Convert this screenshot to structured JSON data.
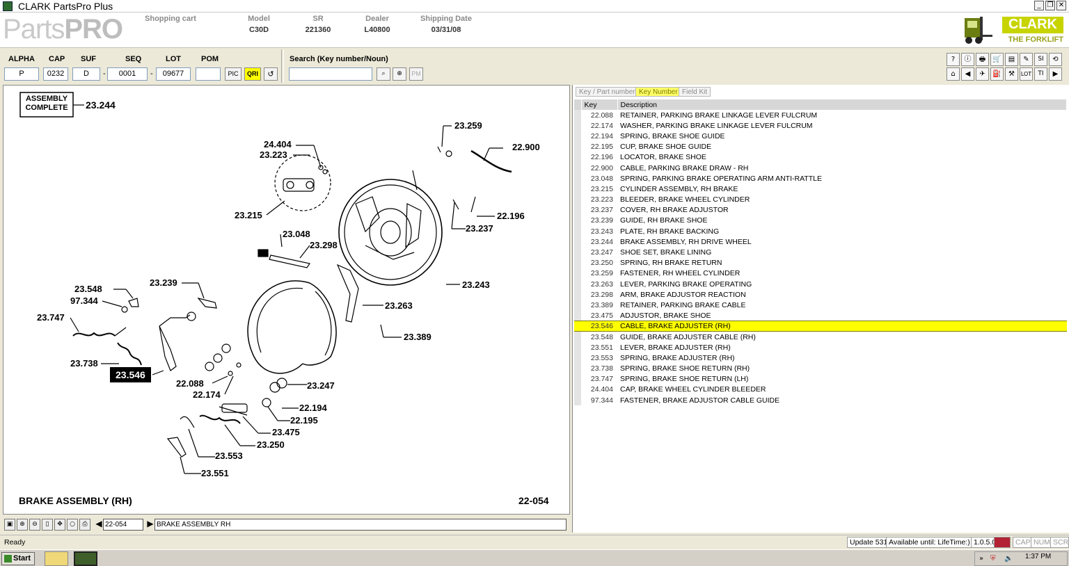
{
  "window": {
    "title": "CLARK PartsPro Plus",
    "minimize": "_",
    "restore": "❐",
    "close": "✕"
  },
  "header": {
    "logo_light": "Parts",
    "logo_bold": "PRO",
    "fields": [
      {
        "label": "Shopping cart",
        "value": ""
      },
      {
        "label": "Model",
        "value": "C30D"
      },
      {
        "label": "SR",
        "value": "221360"
      },
      {
        "label": "Dealer",
        "value": "L40800"
      },
      {
        "label": "Shipping Date",
        "value": "03/31/08"
      }
    ],
    "brand_name": "CLARK",
    "brand_tagline": "THE FORKLIFT",
    "brand_color": "#c8d400"
  },
  "lookup": {
    "alpha_label": "ALPHA",
    "alpha_value": "P",
    "cap_label": "CAP",
    "cap_value": "0232",
    "suf_label": "SUF",
    "suf_value": "D",
    "seq_label": "SEQ",
    "seq_value": "0001",
    "lot_label": "LOT",
    "lot_value": "09677",
    "pom_label": "POM",
    "pom_value": "",
    "dash": "-",
    "pic_button": "PIC",
    "qri_button": "QRI",
    "qri_color": "#ffff00",
    "search_label": "Search (Key number/Noun)",
    "search_value": "",
    "pm_button": "PM"
  },
  "right_toolbar": {
    "row1": [
      "?",
      "ⓘ",
      "🖶",
      "🛒",
      "▤",
      "✎",
      "SI",
      "⟲"
    ],
    "row2": [
      "⌂",
      "◀",
      "✈",
      "⛽",
      "⚒",
      "LOT",
      "TI",
      "▶"
    ]
  },
  "drawing": {
    "assembly_label_line1": "ASSEMBLY",
    "assembly_label_line2": "COMPLETE",
    "assembly_key": "23.244",
    "title": "BRAKE ASSEMBLY (RH)",
    "number": "22-054",
    "highlight_key": "23.546",
    "callouts": [
      "23.259",
      "22.900",
      "24.404",
      "23.223",
      "23.215",
      "22.196",
      "23.237",
      "23.048",
      "23.298",
      "23.243",
      "23.548",
      "97.344",
      "23.239",
      "23.263",
      "23.747",
      "23.389",
      "23.738",
      "22.088",
      "23.247",
      "22.174",
      "22.194",
      "22.195",
      "23.475",
      "23.250",
      "23.553",
      "23.551"
    ]
  },
  "drawing_nav": {
    "page_value": "22-054",
    "description_value": "BRAKE ASSEMBLY RH"
  },
  "parts_panel": {
    "tabs": [
      "Key / Part number",
      "Key Number",
      "Field Kit"
    ],
    "active_tab": 1,
    "columns": [
      "Key",
      "Description"
    ],
    "selected_index": 18,
    "rows": [
      {
        "key": "22.088",
        "desc": "RETAINER, PARKING BRAKE LINKAGE LEVER FULCRUM"
      },
      {
        "key": "22.174",
        "desc": "WASHER, PARKING BRAKE LINKAGE LEVER FULCRUM"
      },
      {
        "key": "22.194",
        "desc": "SPRING, BRAKE SHOE GUIDE"
      },
      {
        "key": "22.195",
        "desc": "CUP, BRAKE SHOE GUIDE"
      },
      {
        "key": "22.196",
        "desc": "LOCATOR, BRAKE SHOE"
      },
      {
        "key": "22.900",
        "desc": "CABLE, PARKING BRAKE DRAW - RH"
      },
      {
        "key": "23.048",
        "desc": "SPRING, PARKING BRAKE OPERATING ARM ANTI-RATTLE"
      },
      {
        "key": "23.215",
        "desc": "CYLINDER ASSEMBLY, RH BRAKE"
      },
      {
        "key": "23.223",
        "desc": "BLEEDER, BRAKE WHEEL CYLINDER"
      },
      {
        "key": "23.237",
        "desc": "COVER, RH BRAKE ADJUSTOR"
      },
      {
        "key": "23.239",
        "desc": "GUIDE, RH BRAKE SHOE"
      },
      {
        "key": "23.243",
        "desc": "PLATE, RH BRAKE BACKING"
      },
      {
        "key": "23.244",
        "desc": "BRAKE ASSEMBLY, RH DRIVE WHEEL"
      },
      {
        "key": "23.247",
        "desc": "SHOE SET, BRAKE LINING"
      },
      {
        "key": "23.250",
        "desc": "SPRING, RH BRAKE RETURN"
      },
      {
        "key": "23.259",
        "desc": "FASTENER, RH WHEEL CYLINDER"
      },
      {
        "key": "23.263",
        "desc": "LEVER, PARKING BRAKE OPERATING"
      },
      {
        "key": "23.298",
        "desc": "ARM, BRAKE ADJUSTOR REACTION"
      },
      {
        "key": "23.389",
        "desc": "RETAINER, PARKING BRAKE CABLE"
      },
      {
        "key": "23.475",
        "desc": "ADJUSTOR, BRAKE SHOE"
      },
      {
        "key": "23.546",
        "desc": "CABLE, BRAKE ADJUSTER (RH)"
      },
      {
        "key": "23.548",
        "desc": "GUIDE, BRAKE ADJUSTER CABLE (RH)"
      },
      {
        "key": "23.551",
        "desc": "LEVER, BRAKE ADJUSTER (RH)"
      },
      {
        "key": "23.553",
        "desc": "SPRING, BRAKE ADJUSTER (RH)"
      },
      {
        "key": "23.738",
        "desc": "SPRING, BRAKE SHOE RETURN (RH)"
      },
      {
        "key": "23.747",
        "desc": "SPRING, BRAKE SHOE RETURN (LH)"
      },
      {
        "key": "24.404",
        "desc": "CAP, BRAKE WHEEL CYLINDER BLEEDER"
      },
      {
        "key": "97.344",
        "desc": "FASTENER, BRAKE ADJUSTOR CABLE GUIDE"
      }
    ]
  },
  "statusbar": {
    "status": "Ready",
    "update": "Update 531",
    "available": "Available until: LifeTime:)",
    "version": "1.0.5.0",
    "cap": "CAP",
    "num": "NUM",
    "scrl": "SCRL"
  },
  "taskbar": {
    "start": "Start",
    "clock": "1:37 PM"
  }
}
